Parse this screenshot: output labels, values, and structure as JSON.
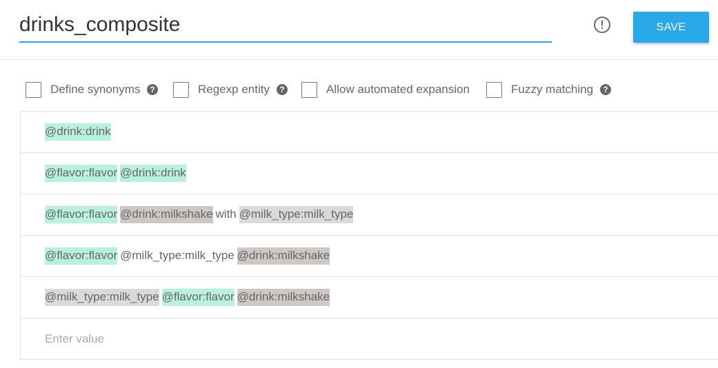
{
  "entity": {
    "name": "drinks_composite"
  },
  "header": {
    "save_label": "SAVE",
    "warning_icon": "exclamation-circle-icon"
  },
  "options": [
    {
      "label": "Define synonyms",
      "checked": false,
      "help": true
    },
    {
      "label": "Regexp entity",
      "checked": false,
      "help": true
    },
    {
      "label": "Allow automated expansion",
      "checked": false,
      "help": false
    },
    {
      "label": "Fuzzy matching",
      "checked": false,
      "help": true
    }
  ],
  "colors": {
    "accent": "#29a8e8",
    "token_green": "#b9f2dc",
    "token_gray": "#dadada",
    "token_dark": "#cdc8c4"
  },
  "rows": [
    {
      "tokens": [
        {
          "text": "@drink:drink",
          "style": "green"
        }
      ]
    },
    {
      "tokens": [
        {
          "text": "@flavor:flavor",
          "style": "green"
        },
        {
          "text": "@drink:drink",
          "style": "green"
        }
      ]
    },
    {
      "tokens": [
        {
          "text": "@flavor:flavor",
          "style": "green"
        },
        {
          "text": "@drink:milkshake",
          "style": "dark"
        },
        {
          "text": "with",
          "style": "plain"
        },
        {
          "text": "@milk_type:milk_type",
          "style": "gray"
        }
      ]
    },
    {
      "tokens": [
        {
          "text": "@flavor:flavor",
          "style": "green"
        },
        {
          "text": "@milk_type:milk_type",
          "style": "plain"
        },
        {
          "text": "@drink:milkshake",
          "style": "dark"
        }
      ]
    },
    {
      "tokens": [
        {
          "text": "@milk_type:milk_type",
          "style": "gray"
        },
        {
          "text": "@flavor:flavor",
          "style": "green"
        },
        {
          "text": "@drink:milkshake",
          "style": "dark"
        }
      ]
    }
  ],
  "new_row": {
    "placeholder": "Enter value"
  }
}
